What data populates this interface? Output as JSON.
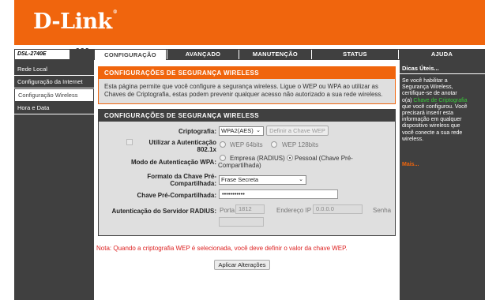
{
  "brand": {
    "logo_text": "D-Link",
    "registered_mark": "®",
    "accent_color": "#f0650d",
    "dark_color": "#404040"
  },
  "model": "DSL-2740E",
  "tabs": [
    {
      "label": "CONFIGURAÇÃO",
      "active": true
    },
    {
      "label": "AVANÇADO",
      "active": false
    },
    {
      "label": "MANUTENÇÃO",
      "active": false
    },
    {
      "label": "STATUS",
      "active": false
    },
    {
      "label": "AJUDA",
      "active": false
    }
  ],
  "sidebar": {
    "items": [
      {
        "label": "Rede Local",
        "active": false
      },
      {
        "label": "Configuração da Internet",
        "active": false
      },
      {
        "label": "Configuração Wireless",
        "active": true
      },
      {
        "label": "Hora e Data",
        "active": false
      }
    ]
  },
  "intro": {
    "title": "CONFIGURAÇÕES DE SEGURANÇA WIRELESS",
    "description": "Esta página permite que você configure a segurança wireless. Ligue o WEP ou WPA ao utilizar as Chaves de Criptografia, estas podem prevenir qualquer acesso não autorizado a sua rede wireless."
  },
  "settings": {
    "title": "CONFIGURAÇÕES DE SEGURANÇA WIRELESS",
    "encryption": {
      "label": "Criptografia:",
      "value": "WPA2(AES)",
      "button": "Definir a Chave WEP"
    },
    "auth_8021x": {
      "label": "Utilizar a Autenticação 802.1x",
      "checked": false,
      "options": [
        "WEP 64bits",
        "WEP 128bits"
      ]
    },
    "wpa_mode": {
      "label": "Modo de Autenticação WPA:",
      "options": [
        "Empresa (RADIUS)",
        "Pessoal (Chave Pré-Compartilhada)"
      ],
      "selected": 1
    },
    "psk_format": {
      "label": "Formato da Chave Pré-Compartilhada:",
      "value": "Frase Secreta"
    },
    "psk": {
      "label": "Chave Pré-Compartilhada:",
      "value": "•••••••••••"
    },
    "radius": {
      "label": "Autenticação do Servidor RADIUS:",
      "port_label": "Porta",
      "port_value": "1812",
      "ip_label": "Endereço IP",
      "ip_value": "0.0.0.0",
      "password_label": "Senha",
      "password_value": ""
    }
  },
  "note": "Nota: Quando a criptografia WEP é selecionada, você deve definir o valor da chave WEP.",
  "apply_button": "Aplicar Alterações",
  "help": {
    "title": "Dicas Úteis...",
    "text_before": "Se você habilitar a Segurança Wireless, certifique-se de anotar o(a)",
    "highlight": "Chave de Criptografia",
    "text_after": "que você configurou. Você precisará inserir esta informação em qualquer dispositivo wireless que você conecte a sua rede wireless.",
    "more": "Mais..."
  }
}
